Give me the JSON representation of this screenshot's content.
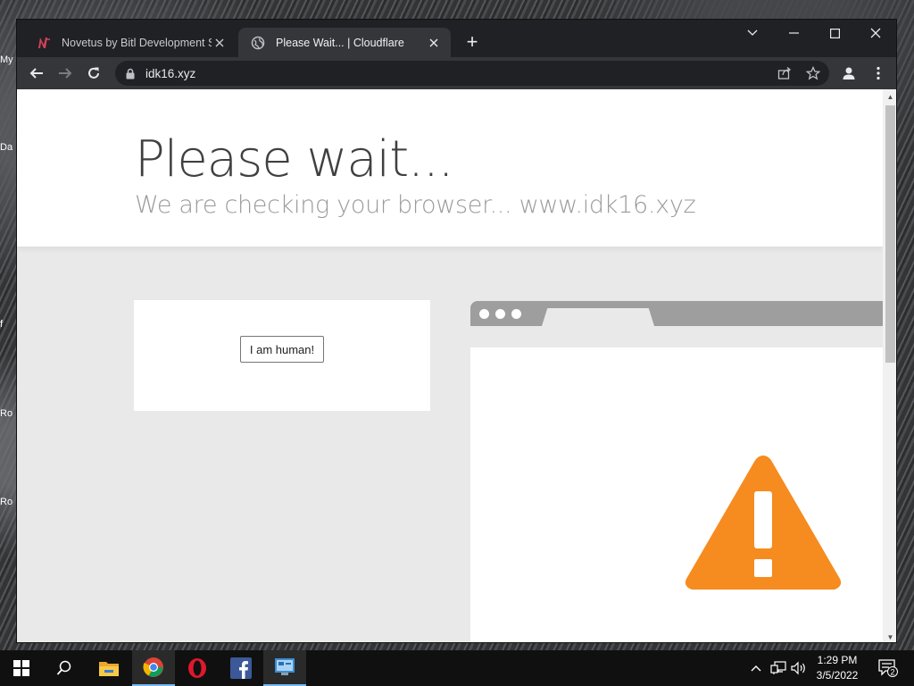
{
  "desktop": {
    "icon_stubs": [
      "My",
      "Da",
      "f",
      "Ro",
      "Ro"
    ]
  },
  "tabs": [
    {
      "title": "Novetus by Bitl Development Stu",
      "favicon": "novetus-n-icon",
      "active": false
    },
    {
      "title": "Please Wait... | Cloudflare",
      "favicon": "globe-icon",
      "active": true
    }
  ],
  "newtab_label": "+",
  "address_bar": {
    "url": "idk16.xyz",
    "lock_icon": "lock-icon"
  },
  "page": {
    "headline": "Please wait...",
    "subline": "We are checking your browser... www.idk16.xyz",
    "human_button_label": "I am human!"
  },
  "colors": {
    "warning_orange": "#f68b1f",
    "chrome_dark": "#202124",
    "chrome_toolbar": "#35363a",
    "page_gray": "#e9e9e9",
    "illus_bar_gray": "#9e9e9e"
  },
  "taskbar": {
    "items": [
      "windows-start",
      "search",
      "file-explorer",
      "google-chrome",
      "opera",
      "facebook",
      "control-panel"
    ],
    "time": "1:29 PM",
    "date": "3/5/2022",
    "notification_count": "2"
  }
}
